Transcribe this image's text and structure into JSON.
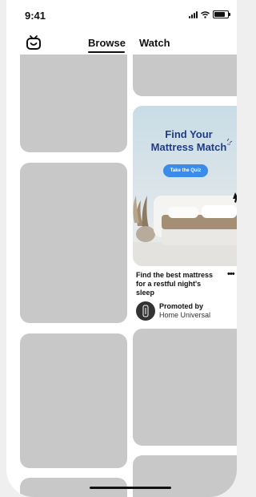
{
  "status_bar": {
    "time": "9:41"
  },
  "top_nav": {
    "tabs": [
      {
        "label": "Browse",
        "active": true
      },
      {
        "label": "Watch",
        "active": false
      }
    ]
  },
  "promo": {
    "headline_line1": "Find Your",
    "headline_line2": "Mattress Match",
    "cta_label": "Take the Quiz",
    "description": "Find the best mattress for a restful night's sleep",
    "more_label": "•••",
    "promoted_label": "Promoted by",
    "advertiser": "Home Universal"
  },
  "colors": {
    "placeholder": "#c8c8c8",
    "headline": "#1f3c86",
    "cta": "#3b8bea"
  }
}
